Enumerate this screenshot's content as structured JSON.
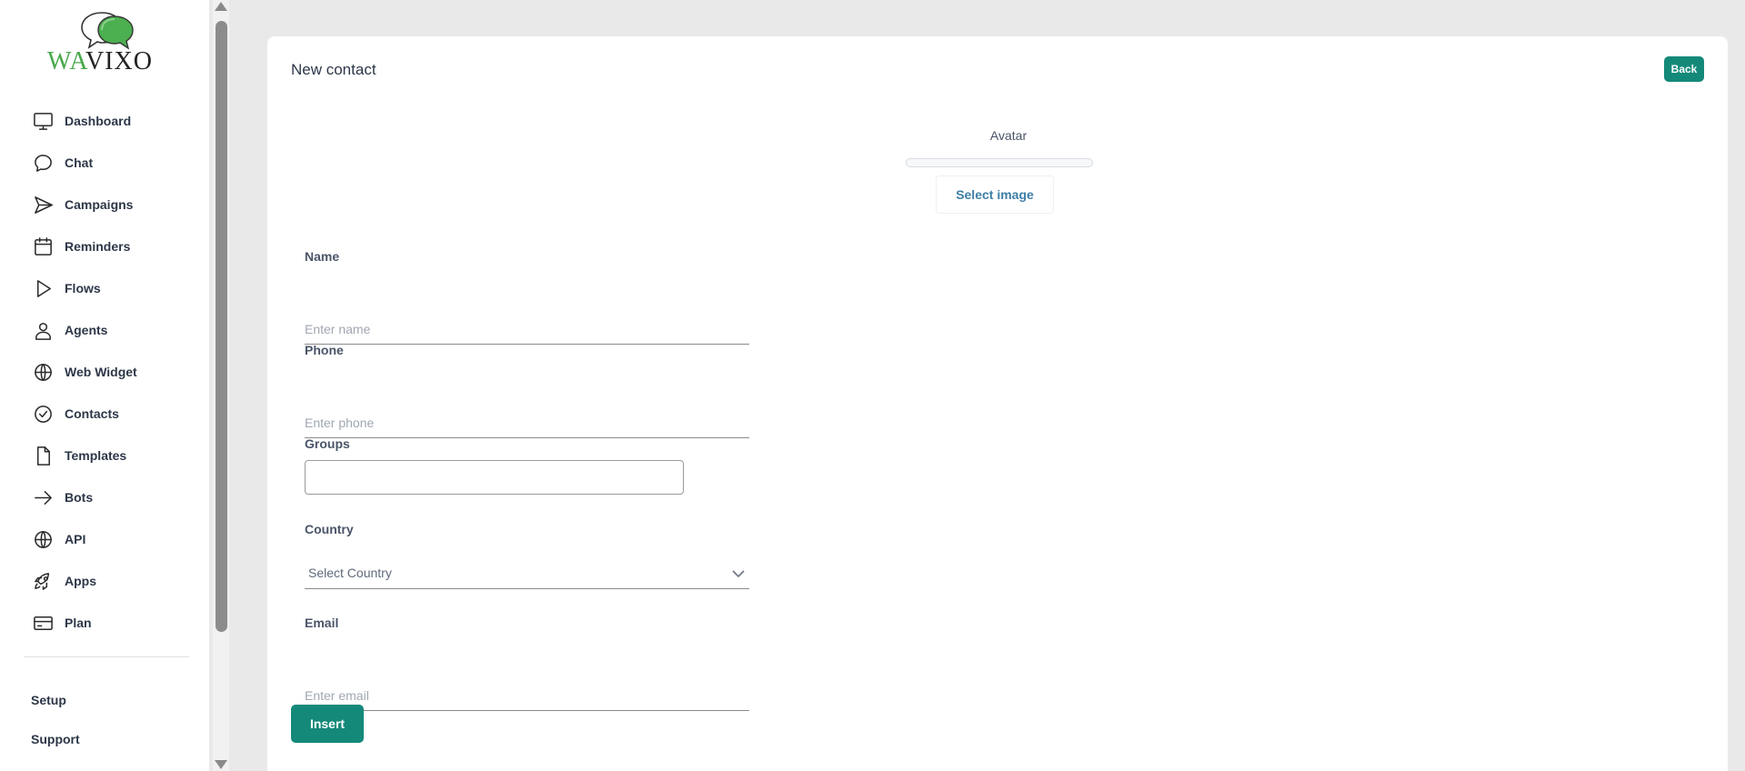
{
  "brand": {
    "logo_part1": "WA",
    "logo_part2": "VIXO",
    "accent": "#47a84a"
  },
  "sidebar": {
    "items": [
      {
        "label": "Dashboard",
        "icon": "monitor-icon"
      },
      {
        "label": "Chat",
        "icon": "chat-bubble-icon"
      },
      {
        "label": "Campaigns",
        "icon": "send-icon"
      },
      {
        "label": "Reminders",
        "icon": "calendar-icon"
      },
      {
        "label": "Flows",
        "icon": "play-icon"
      },
      {
        "label": "Agents",
        "icon": "user-icon"
      },
      {
        "label": "Web Widget",
        "icon": "globe-icon"
      },
      {
        "label": "Contacts",
        "icon": "check-circle-icon"
      },
      {
        "label": "Templates",
        "icon": "file-icon"
      },
      {
        "label": "Bots",
        "icon": "arrow-right-icon"
      },
      {
        "label": "API",
        "icon": "globe-icon"
      },
      {
        "label": "Apps",
        "icon": "rocket-icon"
      },
      {
        "label": "Plan",
        "icon": "credit-card-icon"
      }
    ],
    "setup_label": "Setup",
    "support_label": "Support"
  },
  "page": {
    "title": "New contact",
    "back_label": "Back",
    "primary_color": "#14897a"
  },
  "form": {
    "avatar_label": "Avatar",
    "select_image_label": "Select image",
    "name_label": "Name",
    "name_placeholder": "Enter name",
    "name_value": "",
    "phone_label": "Phone",
    "phone_placeholder": "Enter phone",
    "phone_value": "",
    "groups_label": "Groups",
    "country_label": "Country",
    "country_selected": "Select Country",
    "email_label": "Email",
    "email_placeholder": "Enter email",
    "email_value": "",
    "insert_label": "Insert"
  }
}
